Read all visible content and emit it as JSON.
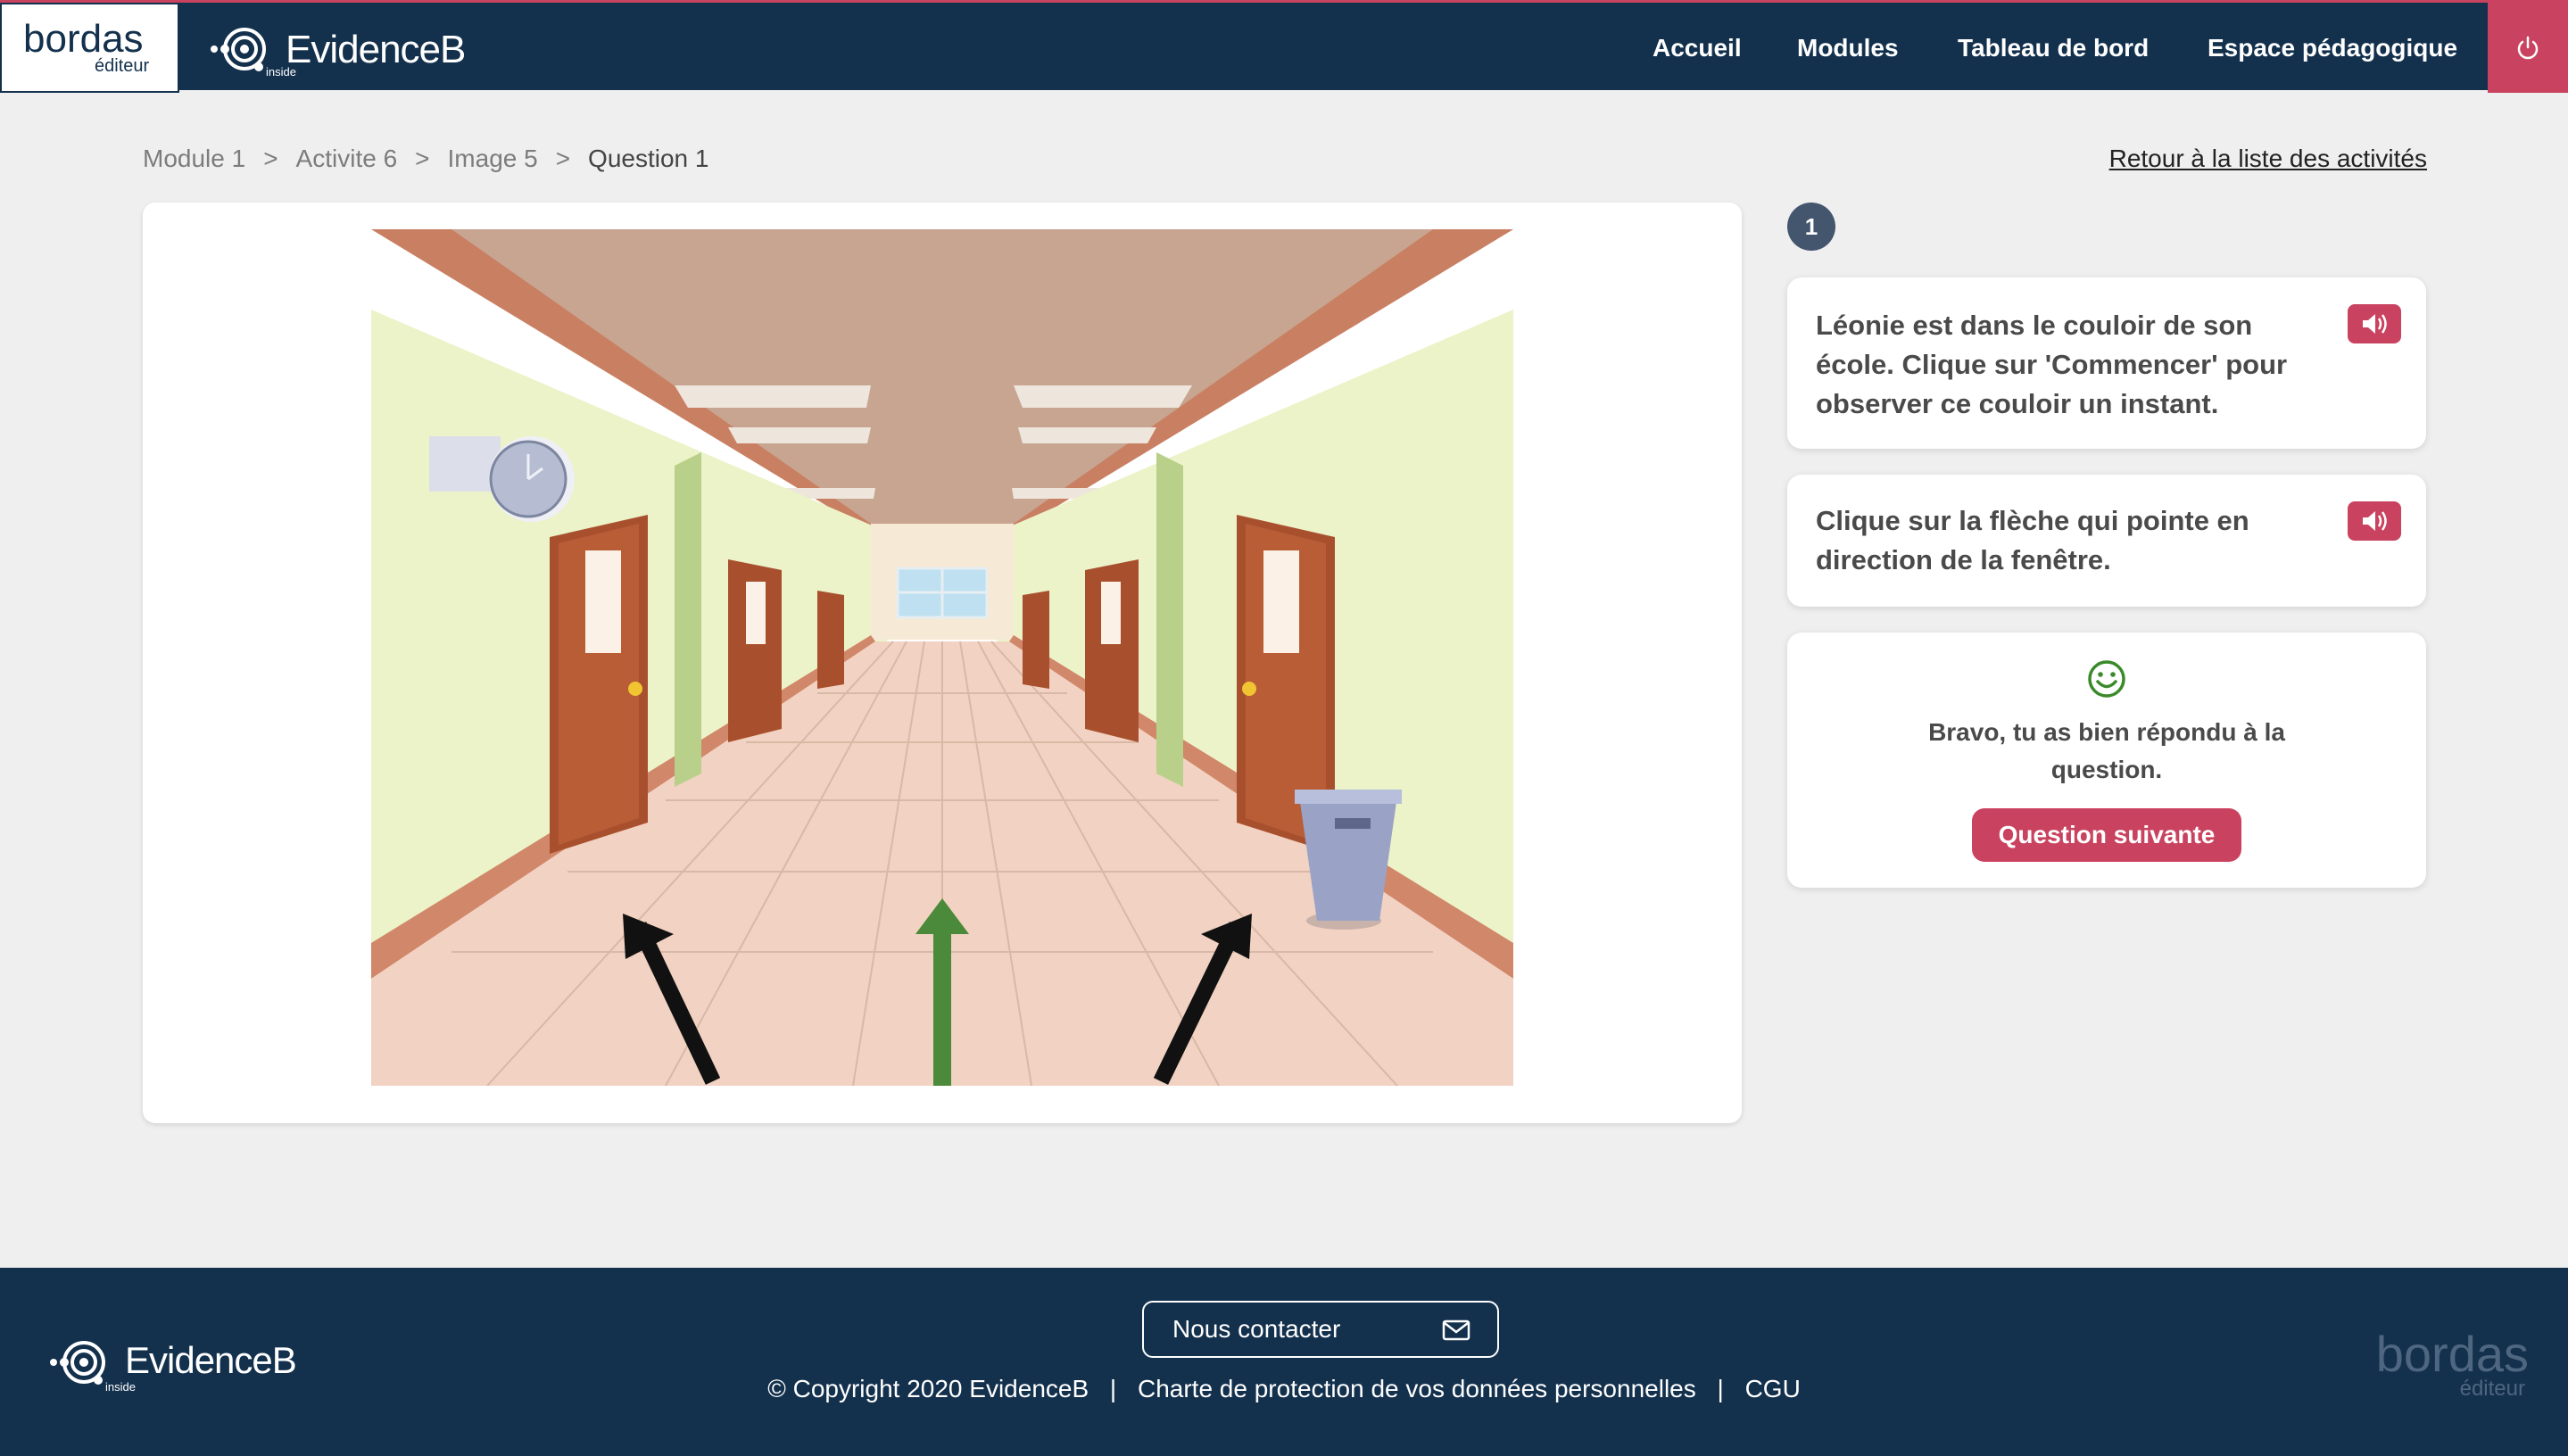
{
  "header": {
    "bordas_logo": {
      "text": "bordas",
      "sub": "éditeur"
    },
    "evidenceb_logo": {
      "text": "EvidenceB",
      "sub": "inside"
    },
    "nav": [
      "Accueil",
      "Modules",
      "Tableau de bord",
      "Espace pédagogique"
    ],
    "power_icon": "power-icon"
  },
  "breadcrumb": [
    "Module 1",
    "Activite 6",
    "Image 5",
    "Question 1"
  ],
  "breadcrumb_separator": ">",
  "back_link": "Retour à la liste des activités",
  "step_badge": "1",
  "instructions": [
    {
      "text": "Léonie est dans le couloir de son école. Clique sur 'Commencer' pour observer ce couloir un instant.",
      "audio_icon": "speaker-icon"
    },
    {
      "text": "Clique sur la flèche qui pointe en direction de la fenêtre.",
      "audio_icon": "speaker-icon"
    }
  ],
  "feedback": {
    "icon": "smiley-icon",
    "message": "Bravo, tu as bien répondu à la question.",
    "next_button": "Question suivante"
  },
  "scene": {
    "description_icon": "hallway-illustration",
    "arrows": [
      {
        "id": "left",
        "color": "#111111"
      },
      {
        "id": "center",
        "color": "#4a8a3a"
      },
      {
        "id": "right",
        "color": "#111111"
      }
    ]
  },
  "footer": {
    "contact_button": "Nous contacter",
    "mail_icon": "mail-icon",
    "copyright": "© Copyright 2020 EvidenceB",
    "privacy_link": "Charte de protection de vos données personnelles",
    "cgu_link": "CGU",
    "separator": "|",
    "evidenceb_logo": {
      "text": "EvidenceB",
      "sub": "inside"
    },
    "bordas_logo": {
      "text": "bordas",
      "sub": "éditeur"
    }
  },
  "colors": {
    "navy": "#13304d",
    "accent": "#c9425f",
    "success": "#3a8a2a",
    "background": "#efefef"
  }
}
